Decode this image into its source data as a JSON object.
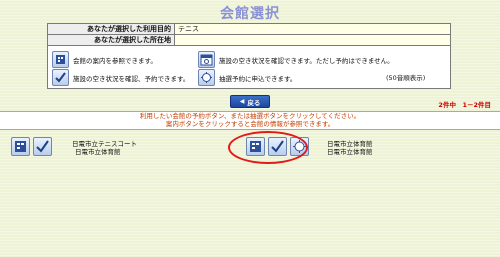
{
  "title": "会館選択",
  "info": {
    "purpose_label": "あなたが選択した利用目的",
    "purpose_value": "テニス",
    "area_label": "あなたが選択した所在地",
    "area_value": ""
  },
  "legend": {
    "guide_text": "会館の案内を参照できます。",
    "vacancy_text": "施設の空き状況を確認できます。ただし予約はできません。",
    "reserve_text": "施設の空き状況を確認、予約できます。",
    "lottery_text": "抽選予約に申込できます。",
    "order_note": "(50音順表示)"
  },
  "back_button": "戻る",
  "count_text": "2件中　1－2件目",
  "instructions": {
    "line1": "利用したい会館の予約ボタン、または抽選ボタンをクリックしてください。",
    "line2": "案内ボタンをクリックすると会館の情報が参照できます。"
  },
  "results": [
    {
      "name": "日電市立テニスコート",
      "sub": "日電市立体育館"
    },
    {
      "name": "日電市立体育館",
      "sub": "日電市立体育館"
    }
  ],
  "colors": {
    "background": "#eef3d6",
    "title": "#8a92d6",
    "instruction_text": "#c23d00",
    "count_text": "#cc0000",
    "highlight_ellipse": "#e01b1b",
    "button": "#1d46a0"
  },
  "icons": {
    "guide": "building-guide-icon",
    "vacancy": "calendar-vacancy-icon",
    "reserve": "checkmark-reserve-icon",
    "lottery": "lottery-icon"
  }
}
